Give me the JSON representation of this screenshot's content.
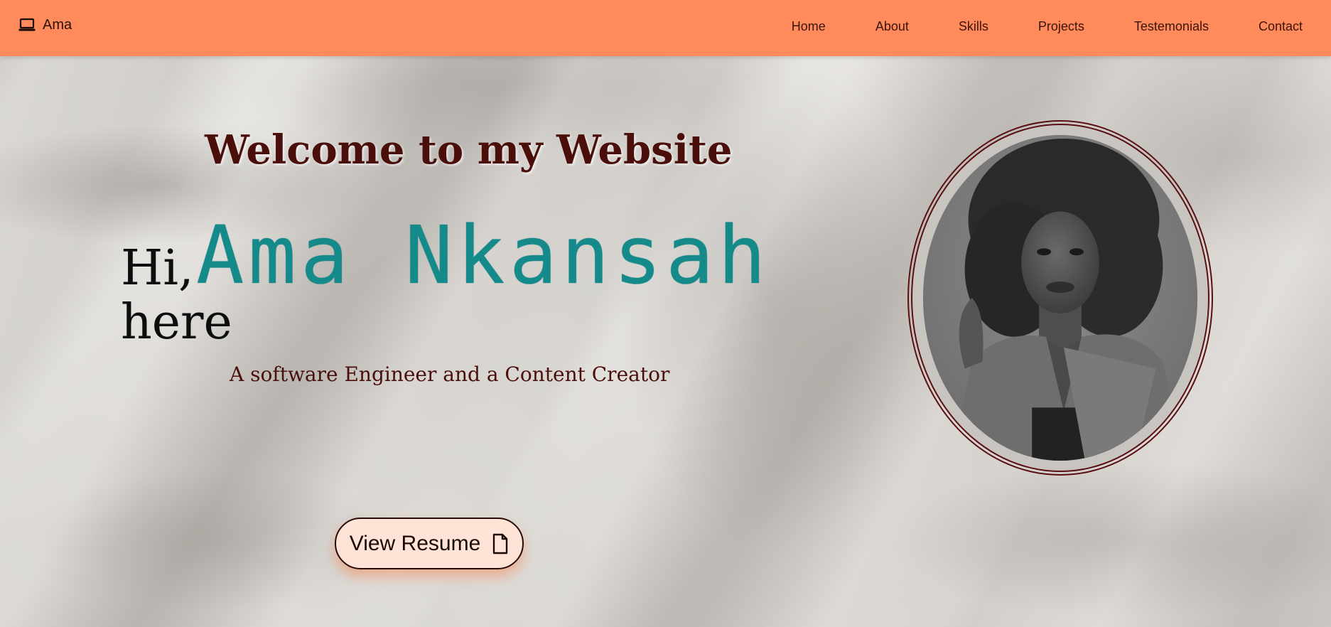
{
  "navbar": {
    "brand": "Ama",
    "brand_icon": "laptop-icon",
    "links": [
      "Home",
      "About",
      "Skills",
      "Projects",
      "Testemonials",
      "Contact"
    ],
    "background": "#ff8a5c"
  },
  "hero": {
    "welcome": "Welcome to my Website",
    "greeting": "Hi,",
    "name": "Ama Nkansah",
    "here": "here",
    "tagline": "A software Engineer and a Content Creator",
    "resume_button": "View Resume",
    "resume_icon": "file-icon",
    "name_color": "#148a8a",
    "accent_color": "#4a0f0a"
  },
  "portrait": {
    "image": "profile-photo"
  }
}
